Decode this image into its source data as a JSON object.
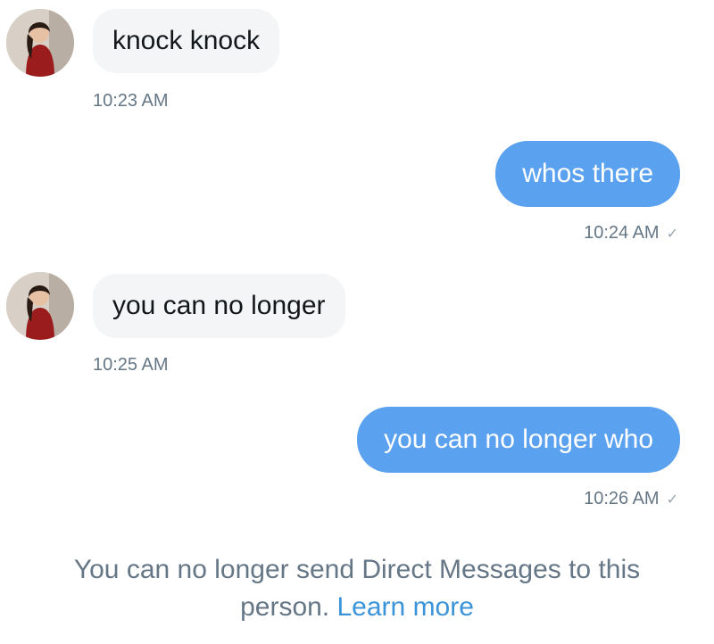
{
  "messages": [
    {
      "direction": "incoming",
      "text": "knock knock",
      "time": "10:23 AM"
    },
    {
      "direction": "outgoing",
      "text": "whos there",
      "time": "10:24 AM",
      "status_icon": "check-icon"
    },
    {
      "direction": "incoming",
      "text": "you can no longer",
      "time": "10:25 AM"
    },
    {
      "direction": "outgoing",
      "text": "you can no longer who",
      "time": "10:26 AM",
      "status_icon": "check-icon"
    }
  ],
  "footer": {
    "line1": "You can no longer send Direct Messages to this",
    "line2_prefix": "person.",
    "learn_more": "Learn more"
  },
  "colors": {
    "outgoing_bubble": "#5aa1f0",
    "incoming_bubble": "#f3f5f7",
    "link": "#3b94d9",
    "secondary_text": "#657786"
  },
  "icons": {
    "check": "✓"
  }
}
